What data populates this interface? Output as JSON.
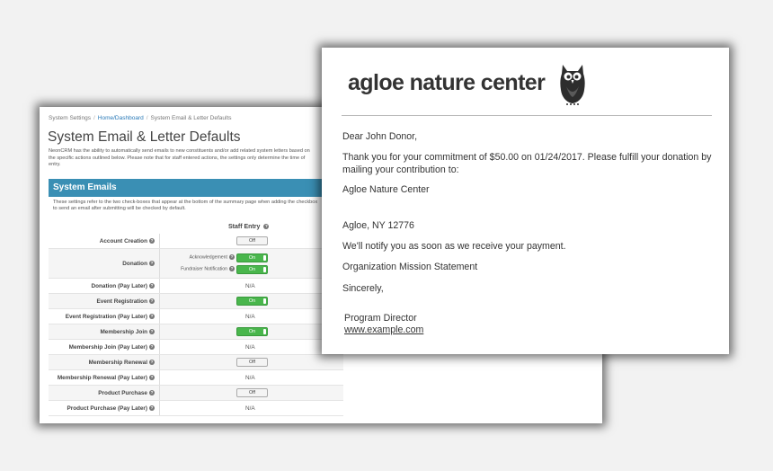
{
  "back_window": {
    "breadcrumb": [
      "System Settings",
      "Home/Dashboard",
      "System Email & Letter Defaults"
    ],
    "title": "System Email & Letter Defaults",
    "intro": "NeonCRM has the ability to automatically send emails to new constituents and/or add related system letters based on the specific actions outlined below. Please note that for staff entered actions, the settings only determine the time of entry.",
    "section_title": "System Emails",
    "section_note": "These settings refer to the two check-boxes that appear at the bottom of the summary page when adding the checkbox to send an email after submitting will be checked by default.",
    "column_header": "Staff Entry",
    "info_glyph": "?",
    "rows": [
      {
        "label": "Account Creation",
        "state": "Off",
        "shade": false
      },
      {
        "label": "Donation",
        "shade": true,
        "subs": [
          {
            "label": "Acknowledgement",
            "state": "On"
          },
          {
            "label": "Fundraiser Notification",
            "state": "On"
          }
        ]
      },
      {
        "label": "Donation (Pay Later)",
        "state": "N/A",
        "shade": false
      },
      {
        "label": "Event Registration",
        "state": "On",
        "shade": true
      },
      {
        "label": "Event Registration (Pay Later)",
        "state": "N/A",
        "shade": false
      },
      {
        "label": "Membership Join",
        "state": "On",
        "shade": true
      },
      {
        "label": "Membership Join (Pay Later)",
        "state": "N/A",
        "shade": false
      },
      {
        "label": "Membership Renewal",
        "state": "Off",
        "shade": true
      },
      {
        "label": "Membership Renewal (Pay Later)",
        "state": "N/A",
        "shade": false
      },
      {
        "label": "Product Purchase",
        "state": "Off",
        "shade": true
      },
      {
        "label": "Product Purchase (Pay Later)",
        "state": "N/A",
        "shade": false
      }
    ]
  },
  "letter": {
    "logo_text": "agloe nature center",
    "logo_icon": "owl-icon",
    "greeting": "Dear John Donor,",
    "body": "Thank you for your commitment of $50.00 on 01/24/2017. Please fulfill your donation by mailing your contribution to:",
    "org_name": "Agloe Nature Center",
    "city_line": "Agloe, NY 12776",
    "notify": "We'll notify you as soon as we receive your payment.",
    "mission": "Organization Mission Statement",
    "closing": "Sincerely,",
    "signature": "Program Director",
    "link": "www.example.com"
  },
  "colors": {
    "section_bar": "#3a8fb4",
    "toggle_on": "#49b64c",
    "link": "#2a5db0"
  }
}
